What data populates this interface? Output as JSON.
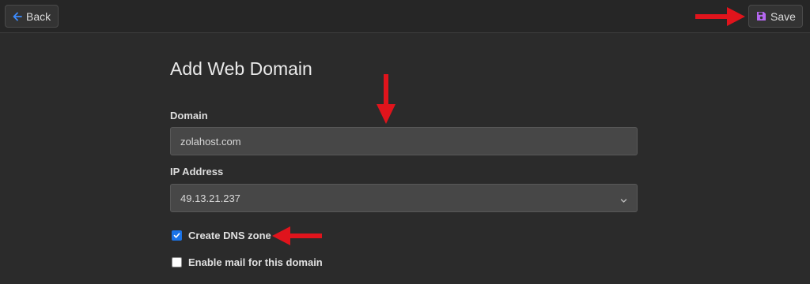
{
  "toolbar": {
    "back_label": "Back",
    "save_label": "Save"
  },
  "form": {
    "title": "Add Web Domain",
    "domain": {
      "label": "Domain",
      "value": "zolahost.com"
    },
    "ip_address": {
      "label": "IP Address",
      "selected": "49.13.21.237"
    },
    "create_dns_zone": {
      "label": "Create DNS zone",
      "checked": true
    },
    "enable_mail": {
      "label": "Enable mail for this domain",
      "checked": false
    }
  },
  "colors": {
    "back_icon": "#3d8bfd",
    "save_icon": "#b467f0",
    "annotation_arrow": "#e0141c",
    "checkbox_checked": "#1a73e8"
  },
  "icons": [
    "arrow-left-icon",
    "floppy-disk-icon",
    "chevron-down-icon",
    "check-icon",
    "annotation-arrow-icon"
  ]
}
